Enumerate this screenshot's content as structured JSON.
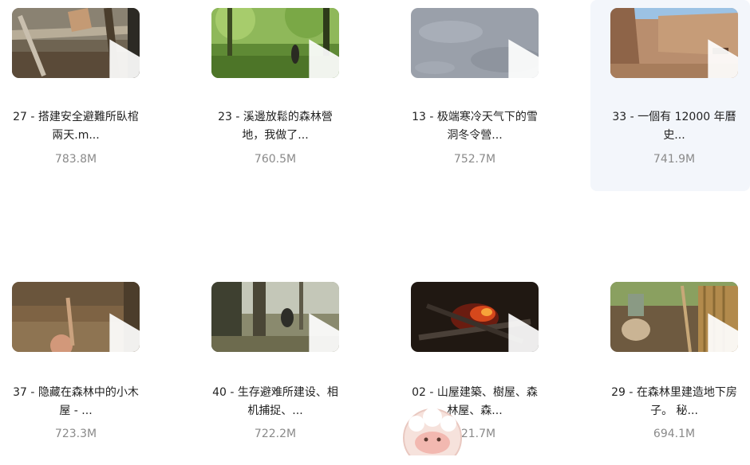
{
  "videos": [
    {
      "title_line1": "27 - 搭建安全避難所臥棺",
      "title_line2": "兩天.m...",
      "size": "783.8M",
      "thumb_icon": "play-icon"
    },
    {
      "title_line1": "23 - 溪邊放鬆的森林營",
      "title_line2": "地，我做了...",
      "size": "760.5M",
      "thumb_icon": "play-icon"
    },
    {
      "title_line1": "13 - 极端寒冷天气下的雪",
      "title_line2": "洞冬令營...",
      "size": "752.7M",
      "thumb_icon": "play-icon"
    },
    {
      "title_line1": "33 - 一個有 12000 年曆",
      "title_line2": "史...",
      "size": "741.9M",
      "thumb_icon": "play-icon"
    },
    {
      "title_line1": "37 - 隐藏在森林中的小木",
      "title_line2": "屋 - ...",
      "size": "723.3M",
      "thumb_icon": "play-icon"
    },
    {
      "title_line1": "40 - 生存避难所建设、相",
      "title_line2": "机捕捉、...",
      "size": "722.2M",
      "thumb_icon": "play-icon"
    },
    {
      "title_line1": "02 - 山屋建築、樹屋、森",
      "title_line2": "林屋、森...",
      "size": "721.7M",
      "thumb_icon": "play-icon"
    },
    {
      "title_line1": "29 - 在森林里建造地下房",
      "title_line2": "子。 秘...",
      "size": "694.1M",
      "thumb_icon": "play-icon"
    }
  ]
}
